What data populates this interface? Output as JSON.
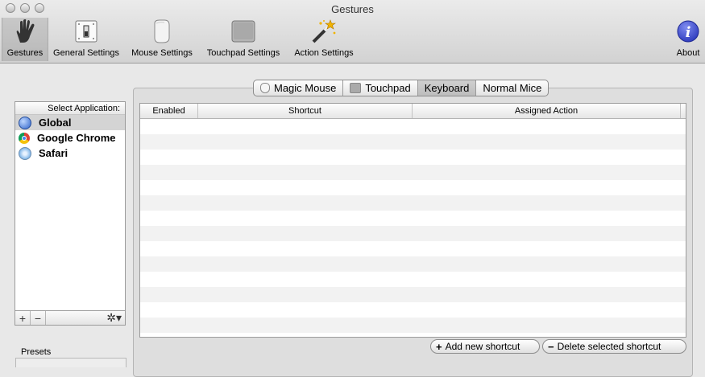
{
  "window": {
    "title": "Gestures"
  },
  "toolbar": [
    {
      "label": "Gestures",
      "icon": "hand-icon"
    },
    {
      "label": "General Settings",
      "icon": "switch-icon"
    },
    {
      "label": "Mouse Settings",
      "icon": "magic-mouse-icon"
    },
    {
      "label": "Touchpad Settings",
      "icon": "touchpad-icon"
    },
    {
      "label": "Action Settings",
      "icon": "magic-wand-icon"
    },
    {
      "label": "About",
      "icon": "info-icon"
    }
  ],
  "apps": {
    "header": "Select Application:",
    "items": [
      {
        "label": "Global",
        "selected": true
      },
      {
        "label": "Google Chrome"
      },
      {
        "label": "Safari"
      }
    ],
    "add": "+",
    "remove": "−",
    "gear": "✲▾"
  },
  "presets": {
    "label": "Presets"
  },
  "segments": [
    {
      "label": "Magic Mouse"
    },
    {
      "label": "Touchpad"
    },
    {
      "label": "Keyboard",
      "selected": true
    },
    {
      "label": "Normal Mice"
    }
  ],
  "table": {
    "columns": [
      "Enabled",
      "Shortcut",
      "Assigned Action"
    ]
  },
  "buttons": {
    "add": {
      "icon": "+",
      "label": "Add new shortcut"
    },
    "delete": {
      "icon": "−",
      "label": "Delete selected shortcut"
    }
  }
}
